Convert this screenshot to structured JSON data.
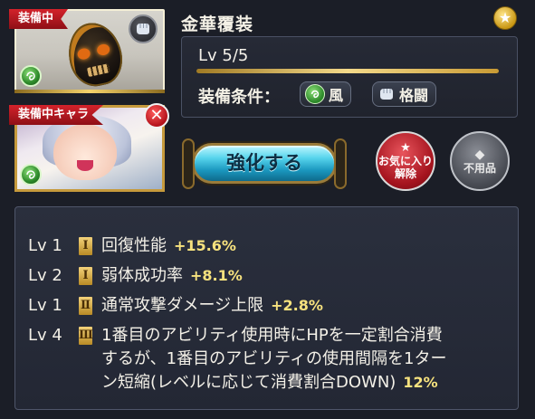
{
  "item": {
    "equipped_label": "装備中",
    "name": "金華覆装",
    "level_text": "Lv 5/5",
    "level_progress": 1.0,
    "conditions_label": "装備条件：",
    "condition_element": "風",
    "condition_weapon": "格闘"
  },
  "character": {
    "equipped_label": "装備中キャラ"
  },
  "actions": {
    "enhance_label": "強化する",
    "unfavorite_line1": "お気に入り",
    "unfavorite_line2": "解除",
    "junk_label": "不用品"
  },
  "skills": [
    {
      "lv": "Lv 1",
      "rank": "Ⅰ",
      "text": "回復性能",
      "value": "+15.6%"
    },
    {
      "lv": "Lv 2",
      "rank": "Ⅰ",
      "text": "弱体成功率",
      "value": "+8.1%"
    },
    {
      "lv": "Lv 1",
      "rank": "Ⅱ",
      "text": "通常攻撃ダメージ上限",
      "value": "+2.8%"
    },
    {
      "lv": "Lv 4",
      "rank": "Ⅲ",
      "text_line1": "1番目のアビリティ使用時にHPを一定割合消費",
      "text_line2": "するが、1番目のアビリティの使用間隔を1ター",
      "text_line3": "ン短縮(レベルに応じて消費割合DOWN)",
      "value": "12%"
    }
  ],
  "colors": {
    "accent_gold": "#f7e27e",
    "enhance_blue": "#56d4ec",
    "fav_red": "#a5141e"
  }
}
